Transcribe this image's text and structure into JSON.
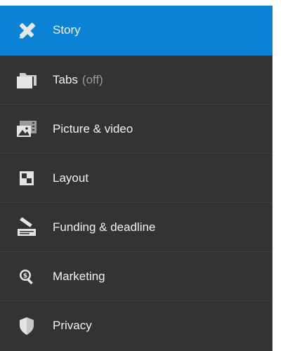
{
  "menu": {
    "active_color": "#0a83d6",
    "background_color": "#333333",
    "items": [
      {
        "label": "Story",
        "suffix": "",
        "icon": "pencil-ruler-icon",
        "active": true
      },
      {
        "label": "Tabs",
        "suffix": "(off)",
        "icon": "folder-icon",
        "active": false
      },
      {
        "label": "Picture & video",
        "suffix": "",
        "icon": "image-film-icon",
        "active": false
      },
      {
        "label": "Layout",
        "suffix": "",
        "icon": "layout-grid-icon",
        "active": false
      },
      {
        "label": "Funding & deadline",
        "suffix": "",
        "icon": "signing-pen-icon",
        "active": false
      },
      {
        "label": "Marketing",
        "suffix": "",
        "icon": "magnifier-dollar-icon",
        "active": false
      },
      {
        "label": "Privacy",
        "suffix": "",
        "icon": "shield-icon",
        "active": false
      }
    ]
  }
}
